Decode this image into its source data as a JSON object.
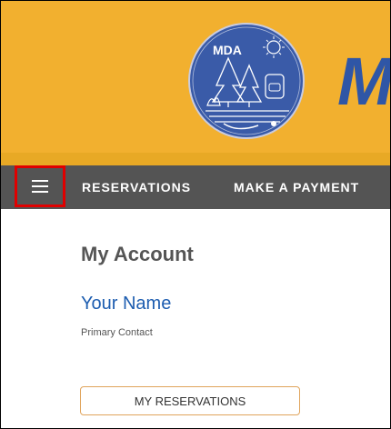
{
  "header": {
    "logo_text": "MDA",
    "brand_partial": "M",
    "colors": {
      "banner": "#f2b02f",
      "logo_circle": "#3a5ba8",
      "brand": "#2f56a6"
    }
  },
  "nav": {
    "menu_icon": "hamburger-icon",
    "items": [
      {
        "label": "RESERVATIONS"
      },
      {
        "label": "MAKE A PAYMENT"
      }
    ],
    "colors": {
      "background": "#545454",
      "highlight": "#e00000"
    }
  },
  "main": {
    "page_title": "My Account",
    "user_name": "Your Name",
    "user_role": "Primary Contact",
    "reservations_button": "MY RESERVATIONS"
  }
}
